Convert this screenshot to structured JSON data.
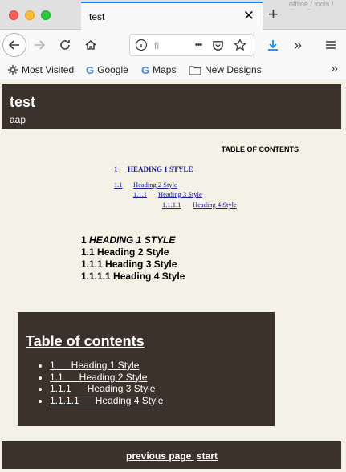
{
  "browser": {
    "tab_title": "test",
    "background_tab_text": "offline / tools / OpenBook",
    "url_text": "fi",
    "url_ellipsis": "•••",
    "bookmarks": [
      {
        "label": "Most Visited",
        "icon": "gear-icon"
      },
      {
        "label": "Google",
        "icon": "google-icon"
      },
      {
        "label": "Maps",
        "icon": "google-icon"
      },
      {
        "label": "New Designs",
        "icon": "folder-icon"
      }
    ],
    "accent_color": "#0a84ff"
  },
  "header": {
    "title": "test",
    "subtitle": "aap"
  },
  "toc_top": {
    "heading": "TABLE OF CONTENTS",
    "entries": [
      {
        "num": "1",
        "label": "HEADING 1 STYLE"
      },
      {
        "num": "1.1",
        "label": "Heading 2 Style"
      },
      {
        "num": "1.1.1",
        "label": "Heading 3 Style"
      },
      {
        "num": "1.1.1.1",
        "label": "Heading 4 Style"
      }
    ]
  },
  "headings": [
    {
      "num": "1",
      "text": "HEADING 1 STYLE"
    },
    {
      "num": "1.1",
      "text": "Heading 2 Style"
    },
    {
      "num": "1.1.1",
      "text": "Heading 3 Style"
    },
    {
      "num": "1.1.1.1",
      "text": "Heading 4 Style"
    }
  ],
  "toc_box": {
    "title": "Table of contents",
    "items": [
      "1      Heading 1 Style",
      "1.1      Heading 2 Style",
      "1.1.1      Heading 3 Style",
      "1.1.1.1      Heading 4 Style"
    ]
  },
  "footer": {
    "previous": "previous page ",
    "start": "start"
  },
  "colors": {
    "dark_panel": "#3b332b",
    "page_bg": "#f4f1e7",
    "link_blue": "#1a1aa0"
  }
}
